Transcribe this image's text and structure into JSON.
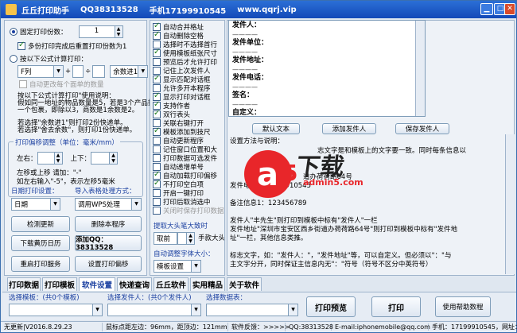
{
  "titlebar": {
    "app": "丘丘打印助手",
    "qq": "QQ38313528",
    "phone": "手机17199910545",
    "site": "www.qqrj.vip"
  },
  "left": {
    "fixed_copies_label": "固定打印份数：",
    "fixed_copies_value": "1",
    "multi_copy_label": "多份打印完成后重置打印份数为1",
    "formula_label": "按以下公式计算打印：",
    "f_op1": "F列",
    "f_plus": "+",
    "f_div": "÷",
    "f_op2": "余数进1",
    "auto_change_label": "自动更改每个面单的数量",
    "note_lines": [
      "按以下公式计算打印\"使用说明：",
      "假如同一地址的物品数量是5，若是3个产品打",
      "一个包裹，即除以3，商数是1余数是2。",
      "",
      "若选择\"余数进1\"则打印2份快递单。",
      "若选择\"舍去余数\"，则打印1份快递单。"
    ],
    "offset_group": "打印偏移调整（单位：毫米/mm）",
    "lr_label": "左右：",
    "ud_label": "上下：",
    "offset_note1": "左移或上移 请加：\"-\"",
    "offset_note2": "如左右输入\"-5\"，表示左移5毫米",
    "date_group": "日期打印设置：",
    "date_value": "日期",
    "import_group": "导入表格处理方式：",
    "import_value": "调用WPS处理",
    "btn_check_update": "检测更新",
    "btn_delete_program": "删除本程序",
    "btn_download_calendar": "下载黄历日历",
    "btn_add_qq": "添加QQ：38313528",
    "btn_restart_print": "重启打印服务",
    "btn_set_offset": "设置打印偏移"
  },
  "mid": {
    "options": [
      {
        "label": "自动合并格址",
        "checked": true
      },
      {
        "label": "自动删除空格",
        "checked": true
      },
      {
        "label": "选择时不选择首行",
        "checked": false
      },
      {
        "label": "使用模板纸张尺寸",
        "checked": true
      },
      {
        "label": "预览后才允许打印",
        "checked": false
      },
      {
        "label": "记住上次发件人",
        "checked": false
      },
      {
        "label": "显示匹配对话框",
        "checked": true
      },
      {
        "label": "允许多开本程序",
        "checked": false
      },
      {
        "label": "显示打印对话框",
        "checked": true
      },
      {
        "label": "支持作者",
        "checked": true
      },
      {
        "label": "双行表头",
        "checked": true
      },
      {
        "label": "关联右键打开",
        "checked": false
      },
      {
        "label": "模板添加到技尺",
        "checked": true
      },
      {
        "label": "自动更新程序",
        "checked": false
      },
      {
        "label": "记住窗口位置和大",
        "checked": false
      },
      {
        "label": "打印数据可选发件",
        "checked": false
      },
      {
        "label": "自动递增单号",
        "checked": false
      },
      {
        "label": "自动加载打印偏移",
        "checked": true
      },
      {
        "label": "不打印空白项",
        "checked": true
      },
      {
        "label": "开启一键打印",
        "checked": false
      },
      {
        "label": "打印后取消选中",
        "checked": false
      },
      {
        "label": "关闭时保存打印数据",
        "checked": false
      }
    ],
    "extract_group": "提取大头笔大致时",
    "extract_value": "取前",
    "extract_btn": "手款大头笔",
    "font_group": "自动调整字体大小：",
    "font_value": "模板设置"
  },
  "right": {
    "preview_lines": [
      "发件人：",
      "发件单位：",
      "发件地址：",
      "发件电话：",
      "签名：",
      "自定义："
    ],
    "btn_default_text": "默认文本",
    "btn_add_sender": "添加发件人",
    "btn_save_sender": "保存发件人",
    "help_title": "设置方法与说明：",
    "help_lines": [
      "志文字是和模板上的文字要一致。同时每条信息以",
      "",
      "",
      "道办荷荷路64号",
      "发件电话：17199910545",
      "",
      "备注信息1：123456789",
      "",
      "发件人\"丰先生\"则打印到模板中标有\"发件人\"一栏",
      "发件地址\"深圳市宝安区西乡街道办荷荷路64号\"则打印到模板中标有\"发件地",
      "址\"一栏，其他信息类推。",
      "",
      "标志文字，如：\"发件人：\"，\"发件地址\"等，可以自定义。但必须以\"：\"与",
      "主文字分开，同时保证主信息内无\"：\"符号（符号不区分中英符号）"
    ]
  },
  "watermark": {
    "brand": "下载",
    "url": "admin5.com"
  },
  "tabs": [
    "打印数据",
    "打印模板",
    "软件设置",
    "快递查询",
    "丘丘软件",
    "实用精品",
    "关于软件"
  ],
  "active_tab": "软件设置",
  "bottom": {
    "template_label": "选择模板：(共0个模板)",
    "sender_label": "选择发件人：(共0个发件人)",
    "data_label": "选择数据表：",
    "btn_preview": "打印预览",
    "btn_print": "打印",
    "btn_help": "使用帮助数程"
  },
  "status": {
    "version": "无更新|V2016.8.29.23",
    "mouse": "鼠标点距左边：96mm，距顶边：121mm",
    "feedback": "软件反馈：>>>>>",
    "qq": "QQ:38313528",
    "email": "E-mail:iphonemobile@qq.com",
    "phone": "手机：17199910545，网址："
  },
  "colors": {
    "title": "#1349b8",
    "accent": "#1a3fa0",
    "panel": "#eef2f7",
    "watermark_red": "#e8262a"
  }
}
